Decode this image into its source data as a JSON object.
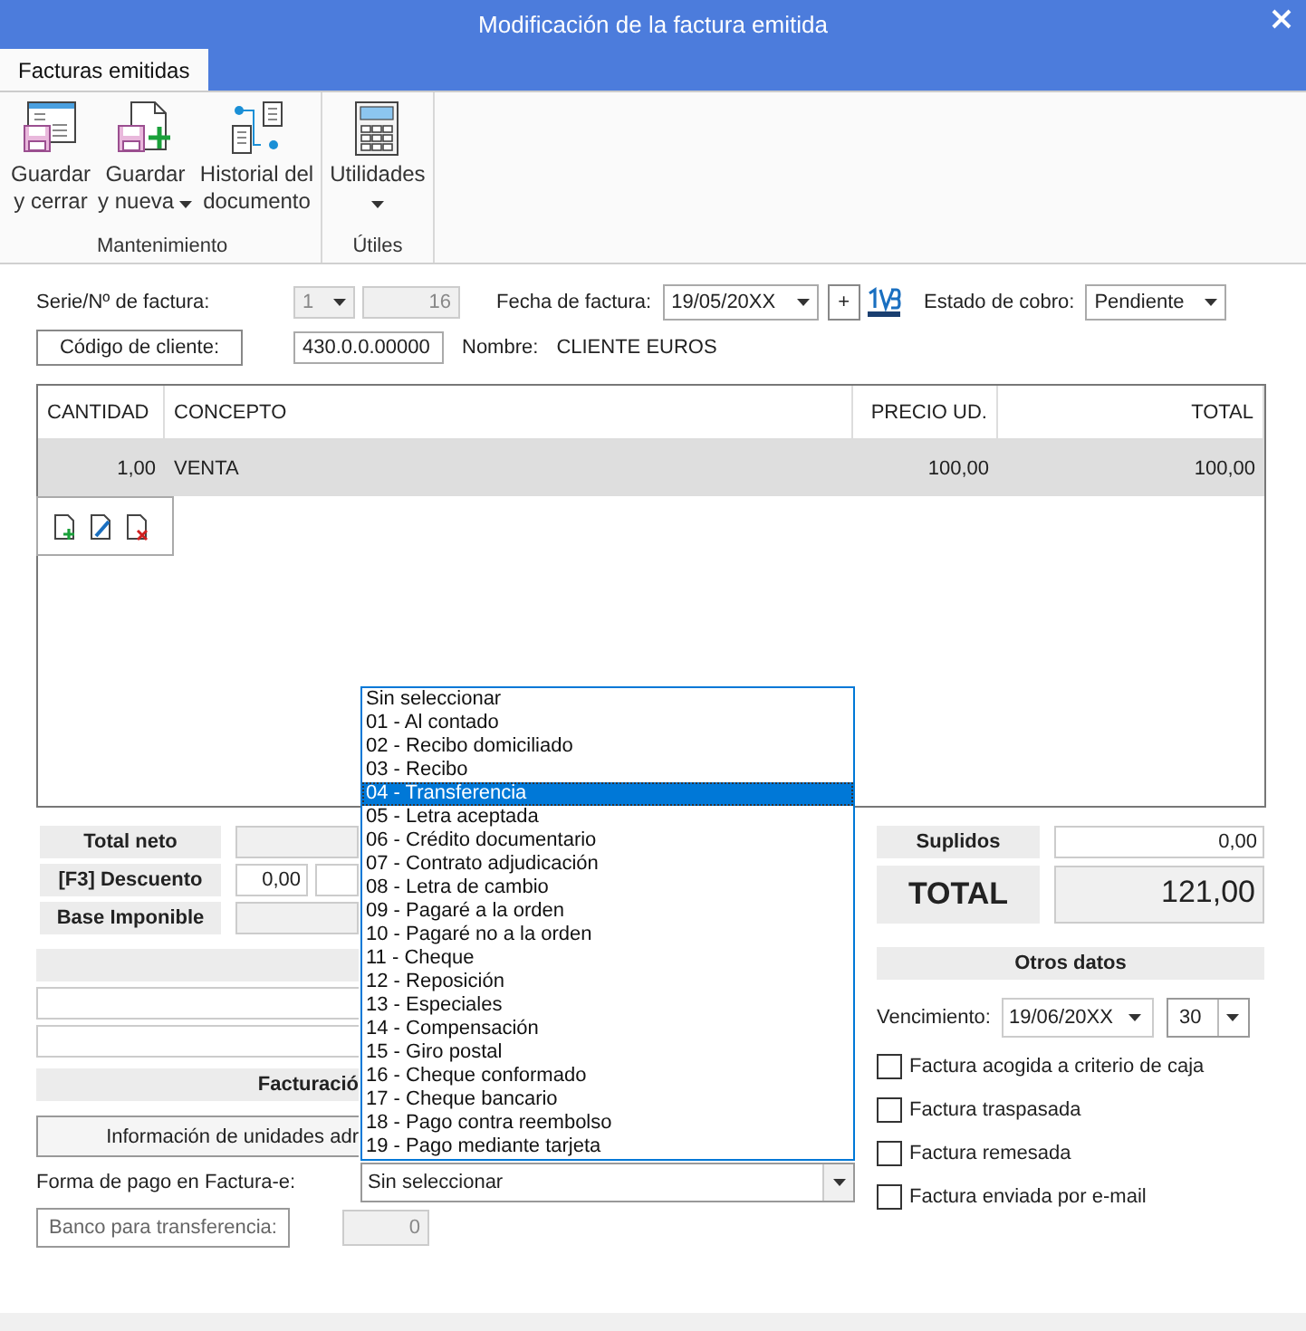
{
  "window": {
    "title": "Modificación de la factura emitida"
  },
  "ribbon": {
    "tabs": [
      {
        "label": "Facturas emitidas",
        "selected": true
      }
    ],
    "groups": [
      {
        "label": "Mantenimiento",
        "buttons": [
          {
            "lines": [
              "Guardar",
              "y cerrar"
            ],
            "dropdown": false
          },
          {
            "lines": [
              "Guardar",
              "y nueva"
            ],
            "dropdown": true
          },
          {
            "lines": [
              "Historial del",
              "documento"
            ],
            "dropdown": false
          }
        ]
      },
      {
        "label": "Útiles",
        "buttons": [
          {
            "lines": [
              "Utilidades"
            ],
            "dropdown": true
          }
        ]
      }
    ]
  },
  "header": {
    "serie_label": "Serie/Nº de factura:",
    "serie": "1",
    "numero": "16",
    "fecha_label": "Fecha de factura:",
    "fecha": "19/05/20XX",
    "plus": "+",
    "estado_label": "Estado de cobro:",
    "estado": "Pendiente",
    "cliente_button": "Código de cliente:",
    "cliente_code": "430.0.0.00000",
    "nombre_label": "Nombre:",
    "nombre": "CLIENTE EUROS"
  },
  "table": {
    "columns": [
      "CANTIDAD",
      "CONCEPTO",
      "PRECIO UD.",
      "TOTAL"
    ],
    "rows": [
      {
        "cells": [
          "1,00",
          "VENTA",
          "100,00",
          "100,00"
        ],
        "selected": true
      }
    ]
  },
  "totals_left": [
    {
      "label": "Total neto"
    },
    {
      "label": "[F3] Descuento",
      "values": [
        "0,00"
      ]
    },
    {
      "label": "Base Imponible"
    }
  ],
  "suplidos": {
    "label": "Suplidos",
    "value": "0,00"
  },
  "total": {
    "label": "TOTAL",
    "value": "121,00"
  },
  "lower_left": {
    "facturacion": "Facturació",
    "info_button": "Información de unidades adr",
    "forma_pago_label": "Forma de pago en Factura-e:",
    "forma_pago_value": "Sin seleccionar",
    "banco_button": "Banco para transferencia:",
    "banco_value": "0"
  },
  "forma_pago_options": [
    {
      "label": "Sin seleccionar",
      "selected": false
    },
    {
      "label": "01 - Al contado",
      "selected": false
    },
    {
      "label": "02 - Recibo domiciliado",
      "selected": false
    },
    {
      "label": "03 - Recibo",
      "selected": false
    },
    {
      "label": "04 - Transferencia",
      "selected": true
    },
    {
      "label": "05 - Letra aceptada",
      "selected": false
    },
    {
      "label": "06 - Crédito documentario",
      "selected": false
    },
    {
      "label": "07 - Contrato adjudicación",
      "selected": false
    },
    {
      "label": "08 - Letra de cambio",
      "selected": false
    },
    {
      "label": "09 - Pagaré a la orden",
      "selected": false
    },
    {
      "label": "10 - Pagaré no a la orden",
      "selected": false
    },
    {
      "label": "11 - Cheque",
      "selected": false
    },
    {
      "label": "12 - Reposición",
      "selected": false
    },
    {
      "label": "13 - Especiales",
      "selected": false
    },
    {
      "label": "14 - Compensación",
      "selected": false
    },
    {
      "label": "15 - Giro postal",
      "selected": false
    },
    {
      "label": "16 - Cheque conformado",
      "selected": false
    },
    {
      "label": "17 - Cheque bancario",
      "selected": false
    },
    {
      "label": "18 - Pago contra reembolso",
      "selected": false
    },
    {
      "label": "19 - Pago mediante tarjeta",
      "selected": false
    }
  ],
  "otros_datos": {
    "title": "Otros datos",
    "vencimiento_label": "Vencimiento:",
    "vencimiento": "19/06/20XX",
    "dias": "30"
  },
  "checkboxes": [
    {
      "label": "Factura acogida a criterio de caja",
      "checked": false
    },
    {
      "label": "Factura traspasada",
      "checked": false
    },
    {
      "label": "Factura remesada",
      "checked": false
    },
    {
      "label": "Factura enviada por e-mail",
      "checked": false
    }
  ]
}
